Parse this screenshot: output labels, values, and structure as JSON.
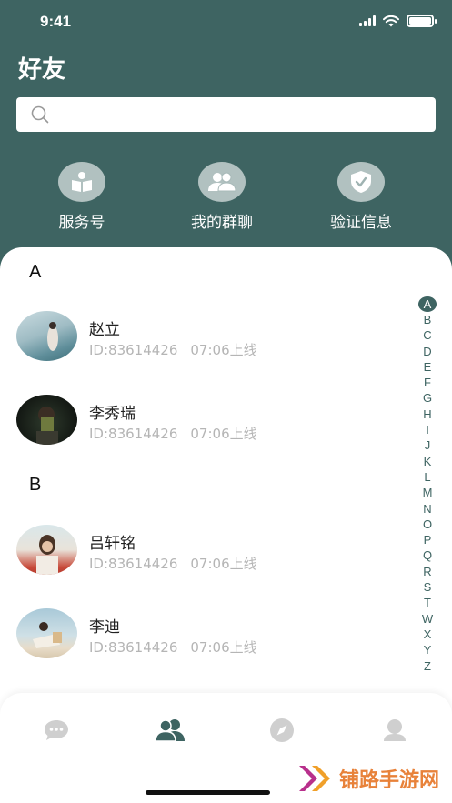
{
  "status": {
    "time": "9:41"
  },
  "header": {
    "title": "好友"
  },
  "search": {
    "placeholder": ""
  },
  "quick_actions": [
    {
      "label": "服务号",
      "icon": "book-icon"
    },
    {
      "label": "我的群聊",
      "icon": "group-icon"
    },
    {
      "label": "验证信息",
      "icon": "shield-check-icon"
    }
  ],
  "sections": [
    {
      "letter": "A",
      "contacts": [
        {
          "name": "赵立",
          "id": "ID:83614426",
          "status": "07:06上线"
        },
        {
          "name": "李秀瑞",
          "id": "ID:83614426",
          "status": "07:06上线"
        }
      ]
    },
    {
      "letter": "B",
      "contacts": [
        {
          "name": "吕轩铭",
          "id": "ID:83614426",
          "status": "07:06上线"
        },
        {
          "name": "李迪",
          "id": "ID:83614426",
          "status": "07:06上线"
        }
      ]
    }
  ],
  "alpha_index": [
    "A",
    "B",
    "C",
    "D",
    "E",
    "F",
    "G",
    "H",
    "I",
    "J",
    "K",
    "L",
    "M",
    "N",
    "O",
    "P",
    "Q",
    "R",
    "S",
    "T",
    "W",
    "X",
    "Y",
    "Z"
  ],
  "alpha_active": "A",
  "tabs": [
    {
      "icon": "chat-bubble-icon",
      "active": false
    },
    {
      "icon": "friends-icon",
      "active": true
    },
    {
      "icon": "compass-icon",
      "active": false
    },
    {
      "icon": "profile-icon",
      "active": false
    }
  ],
  "watermark": {
    "text": "铺路手游网"
  },
  "colors": {
    "accent": "#3e6462",
    "inactive_icon": "#cfcfcf",
    "meta_text": "#b5b5b5",
    "watermark": "#e8823a"
  }
}
